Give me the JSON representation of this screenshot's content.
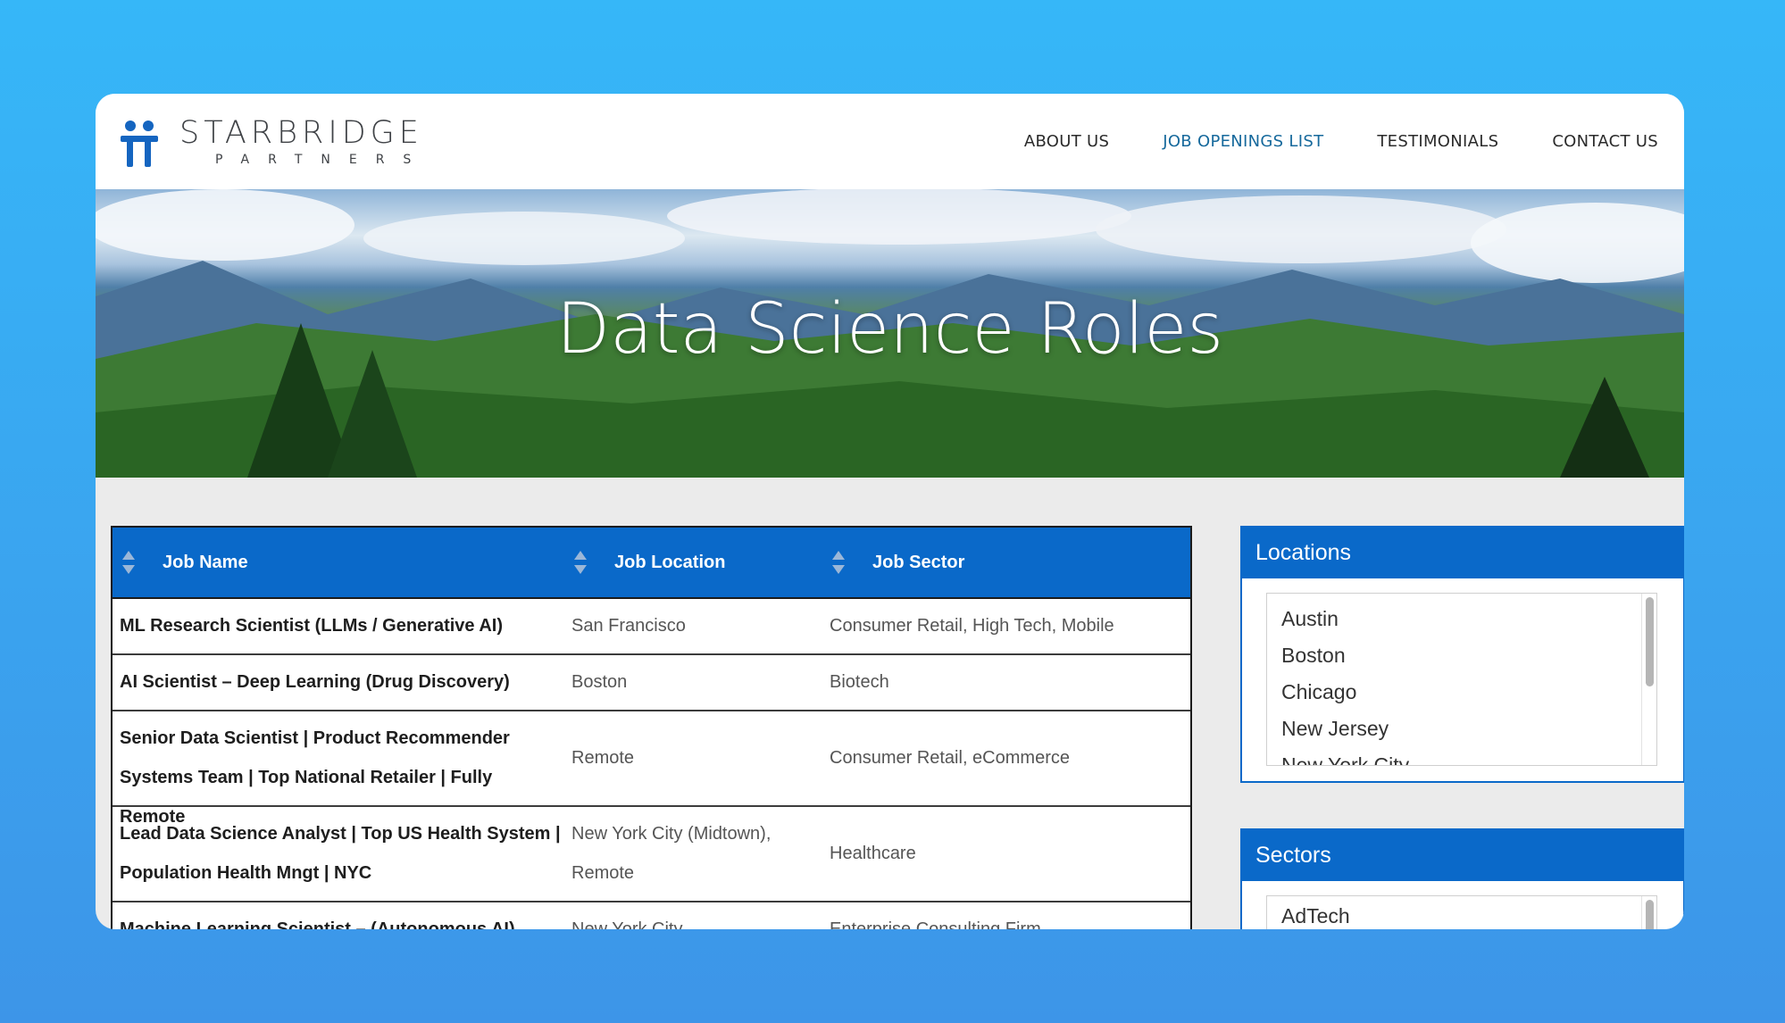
{
  "logo": {
    "name": "STARBRIDGE",
    "sub": "PARTNERS"
  },
  "nav": [
    {
      "label": "ABOUT US",
      "active": false
    },
    {
      "label": "JOB OPENINGS LIST",
      "active": true
    },
    {
      "label": "TESTIMONIALS",
      "active": false
    },
    {
      "label": "CONTACT US",
      "active": false
    }
  ],
  "hero": {
    "title": "Data Science Roles"
  },
  "table": {
    "headers": [
      "Job Name",
      "Job Location",
      "Job Sector"
    ],
    "rows": [
      {
        "name": "ML Research Scientist (LLMs / Generative AI)",
        "location": "San Francisco",
        "sector": "Consumer Retail, High Tech, Mobile"
      },
      {
        "name": "AI Scientist – Deep Learning (Drug Discovery)",
        "location": "Boston",
        "sector": "Biotech"
      },
      {
        "name": "Senior Data Scientist | Product Recommender Systems Team | Top National Retailer | Fully Remote",
        "location": "Remote",
        "sector": "Consumer Retail, eCommerce"
      },
      {
        "name": "Lead Data Science Analyst | Top US Health System | Population Health Mngt | NYC",
        "location": "New York City (Midtown), Remote",
        "sector": "Healthcare"
      },
      {
        "name": "Machine Learning Scientist – (Autonomous AI)",
        "location": "New York City",
        "sector": "Enterprise Consulting Firm"
      }
    ]
  },
  "sidebar": {
    "locations": {
      "title": "Locations",
      "items": [
        "Austin",
        "Boston",
        "Chicago",
        "New Jersey",
        "New York City"
      ]
    },
    "sectors": {
      "title": "Sectors",
      "items": [
        "AdTech"
      ]
    }
  },
  "colors": {
    "primary": "#0a69c9",
    "nav_active": "#16699c",
    "background": "#3aa6f2"
  }
}
